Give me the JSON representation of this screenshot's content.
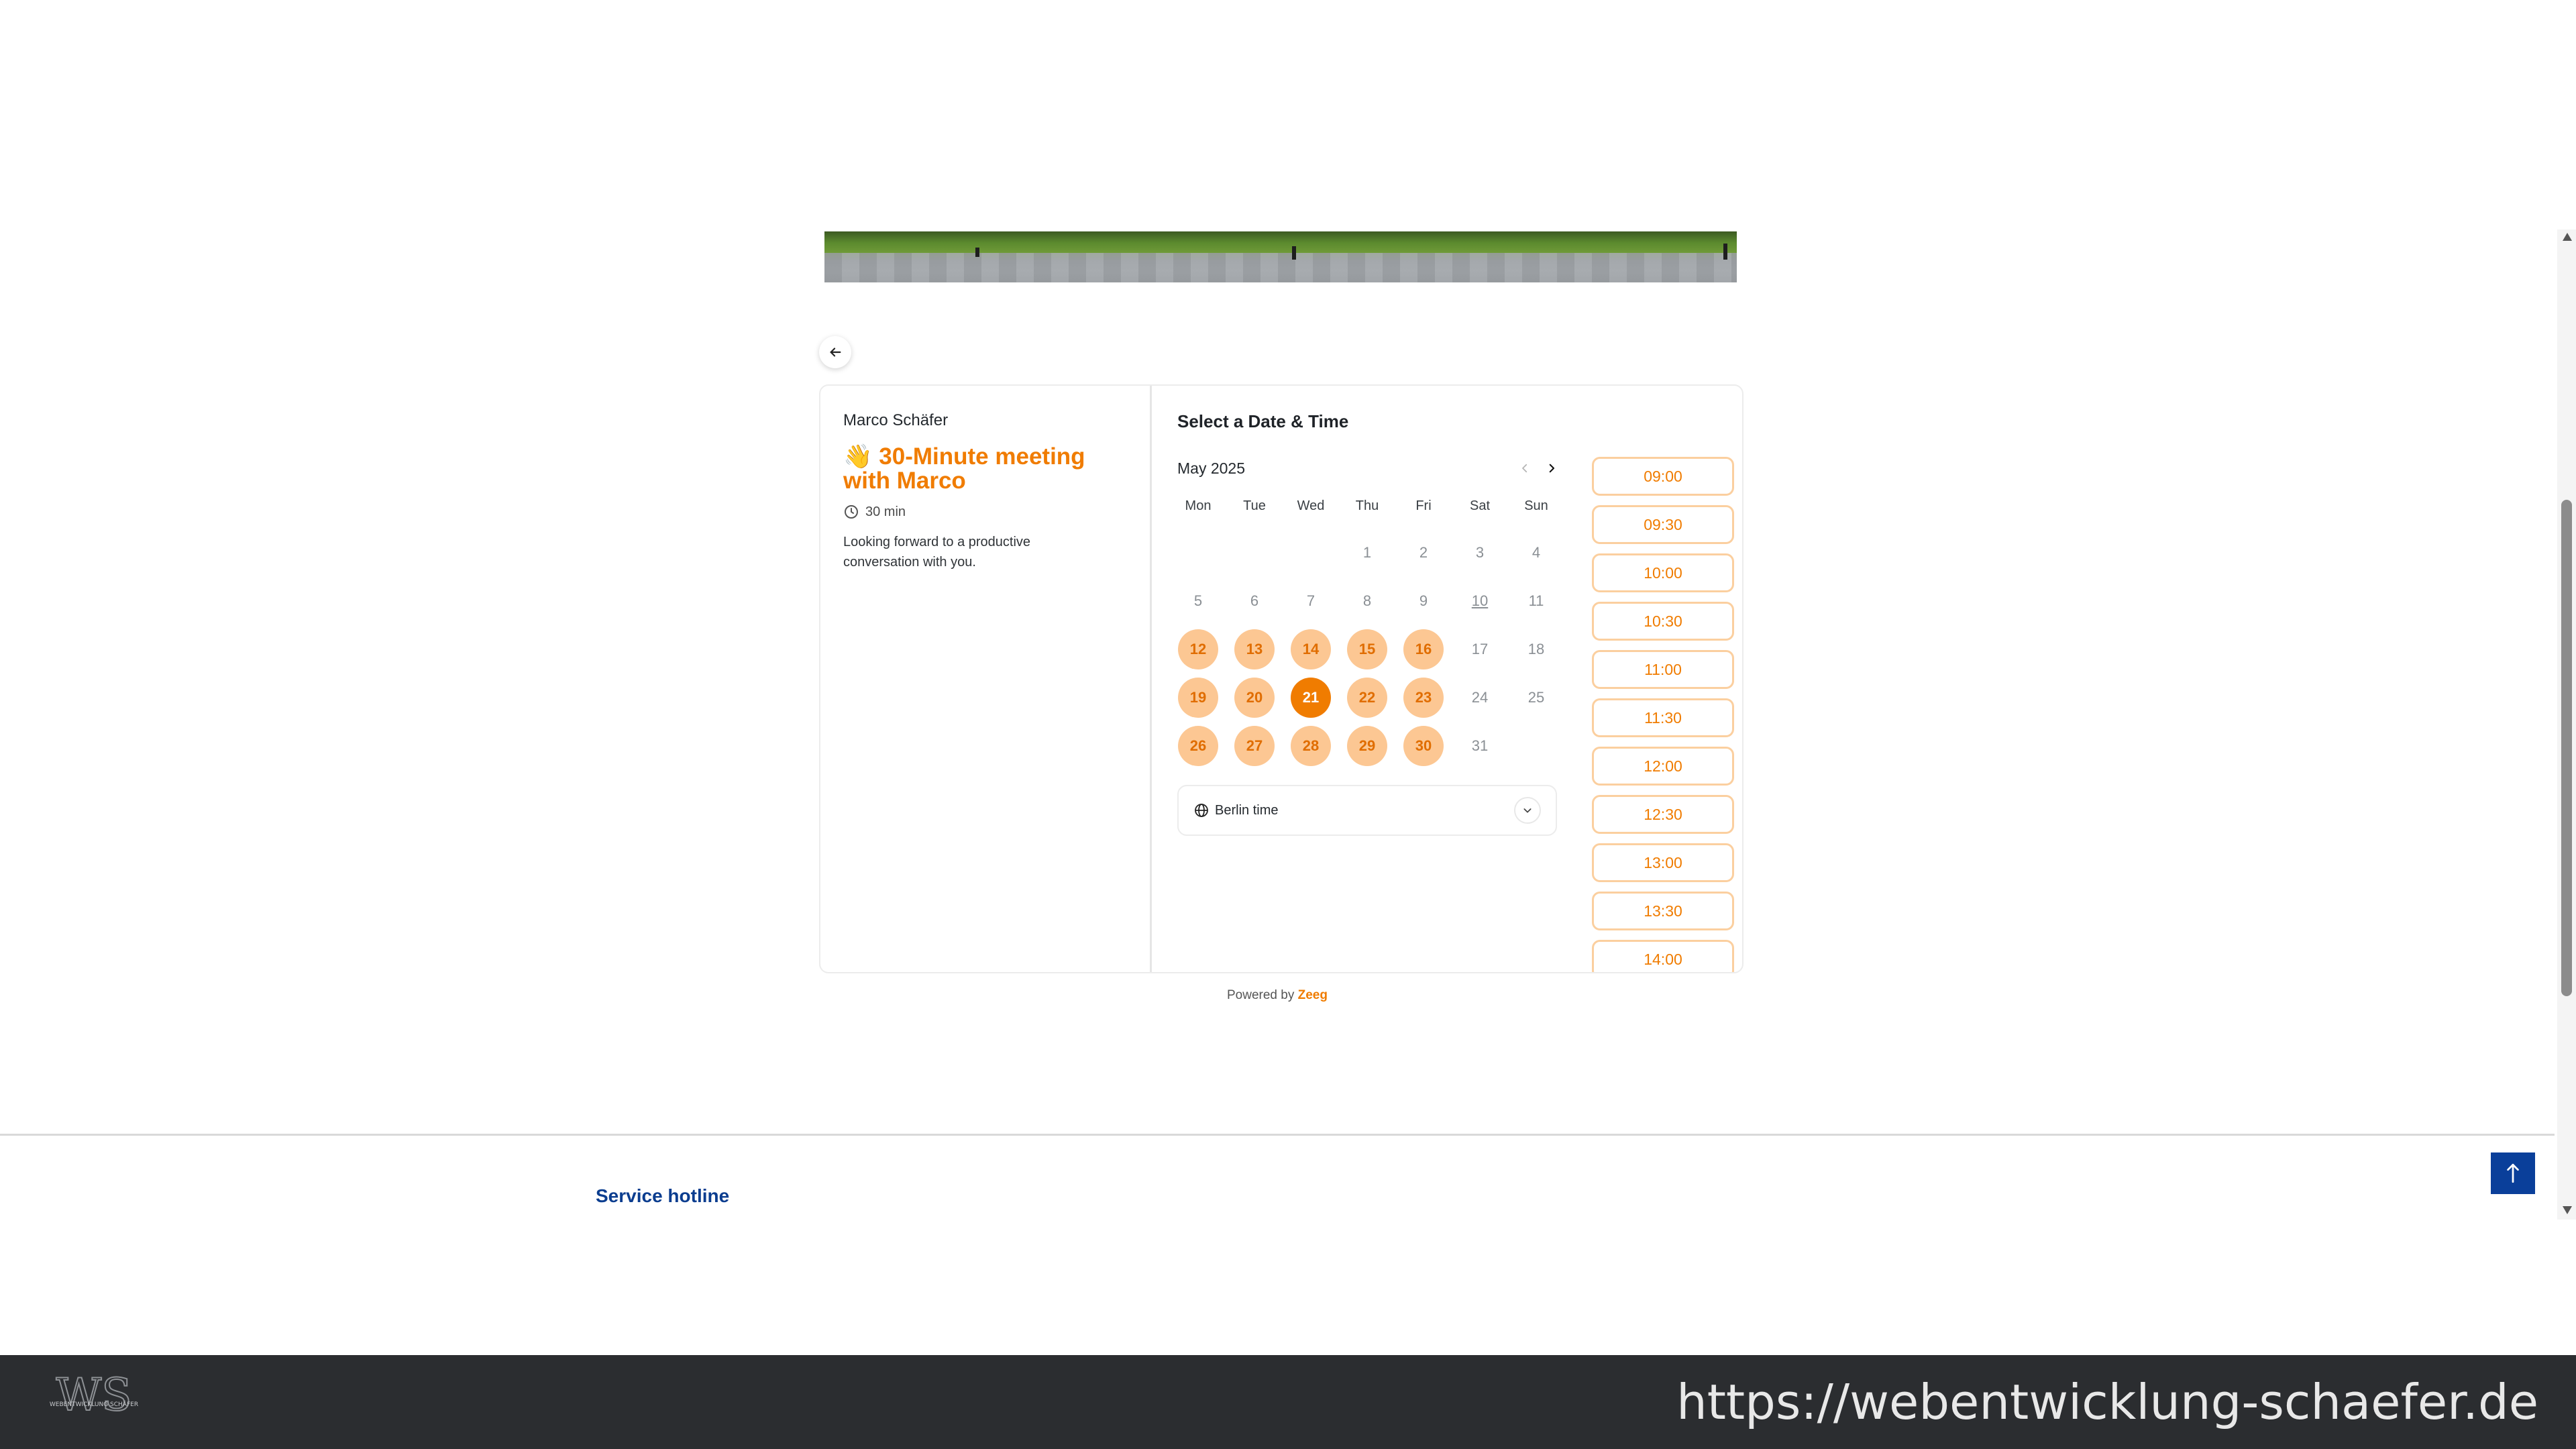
{
  "event": {
    "host_name": "Marco Schäfer",
    "title": "👋 30-Minute meeting with Marco",
    "duration": "30 min",
    "description": "Looking forward to a productive conversation with you."
  },
  "scheduler": {
    "heading": "Select a Date & Time",
    "month_label": "May 2025",
    "weekdays": [
      "Mon",
      "Tue",
      "Wed",
      "Thu",
      "Fri",
      "Sat",
      "Sun"
    ],
    "days": [
      {
        "label": "",
        "state": "empty"
      },
      {
        "label": "",
        "state": "empty"
      },
      {
        "label": "",
        "state": "empty"
      },
      {
        "label": "1",
        "state": "disabled"
      },
      {
        "label": "2",
        "state": "disabled"
      },
      {
        "label": "3",
        "state": "disabled"
      },
      {
        "label": "4",
        "state": "disabled"
      },
      {
        "label": "5",
        "state": "disabled"
      },
      {
        "label": "6",
        "state": "disabled"
      },
      {
        "label": "7",
        "state": "disabled"
      },
      {
        "label": "8",
        "state": "disabled"
      },
      {
        "label": "9",
        "state": "disabled"
      },
      {
        "label": "10",
        "state": "today"
      },
      {
        "label": "11",
        "state": "disabled"
      },
      {
        "label": "12",
        "state": "available"
      },
      {
        "label": "13",
        "state": "available"
      },
      {
        "label": "14",
        "state": "available"
      },
      {
        "label": "15",
        "state": "available"
      },
      {
        "label": "16",
        "state": "available"
      },
      {
        "label": "17",
        "state": "disabled"
      },
      {
        "label": "18",
        "state": "disabled"
      },
      {
        "label": "19",
        "state": "available"
      },
      {
        "label": "20",
        "state": "available"
      },
      {
        "label": "21",
        "state": "selected"
      },
      {
        "label": "22",
        "state": "available"
      },
      {
        "label": "23",
        "state": "available"
      },
      {
        "label": "24",
        "state": "disabled"
      },
      {
        "label": "25",
        "state": "disabled"
      },
      {
        "label": "26",
        "state": "available"
      },
      {
        "label": "27",
        "state": "available"
      },
      {
        "label": "28",
        "state": "available"
      },
      {
        "label": "29",
        "state": "available"
      },
      {
        "label": "30",
        "state": "available"
      },
      {
        "label": "31",
        "state": "disabled"
      }
    ],
    "timezone_label": "Berlin time",
    "time_slots": [
      "09:00",
      "09:30",
      "10:00",
      "10:30",
      "11:00",
      "11:30",
      "12:00",
      "12:30",
      "13:00",
      "13:30",
      "14:00"
    ]
  },
  "powered_by": {
    "prefix": "Powered by",
    "brand": "Zeeg"
  },
  "footer": {
    "service_hotline": "Service hotline"
  },
  "bottom_bar": {
    "logo_text": "WS",
    "logo_subtext": "WEBENTWICKLUNG SCHÄFER",
    "url": "https://webentwicklung-schaefer.de"
  },
  "colors": {
    "accent": "#f07c00",
    "accent_light": "#fcc793",
    "link_blue": "#0b3d8f",
    "scroll_top_bg": "#0a3f9a",
    "bottom_bar_bg": "#2b2d30"
  }
}
